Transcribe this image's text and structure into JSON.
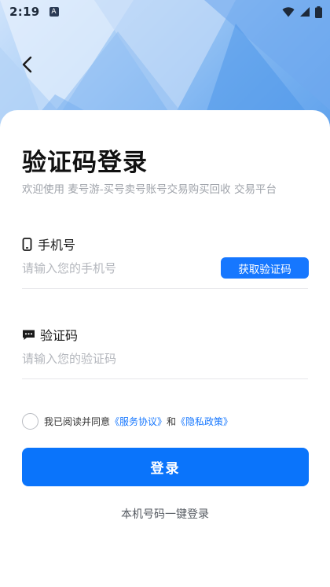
{
  "status_bar": {
    "time": "2:19",
    "indicator": "A",
    "icons": [
      "wifi-icon",
      "signal-icon",
      "battery-icon"
    ]
  },
  "header": {
    "back_icon": "chevron-left-icon"
  },
  "main": {
    "title": "验证码登录",
    "subtitle": "欢迎使用 麦号游-买号卖号账号交易购买回收 交易平台"
  },
  "phone_field": {
    "icon": "phone-icon",
    "label": "手机号",
    "placeholder": "请输入您的手机号",
    "value": "",
    "get_code_label": "获取验证码"
  },
  "code_field": {
    "icon": "message-icon",
    "label": "验证码",
    "placeholder": "请输入您的验证码",
    "value": ""
  },
  "agreement": {
    "checked": false,
    "prefix": "我已阅读并同意",
    "service_link": "《服务协议》",
    "conjunction": "和",
    "privacy_link": "《隐私政策》"
  },
  "login_button": {
    "label": "登录"
  },
  "one_key_login": {
    "label": "本机号码一键登录"
  },
  "colors": {
    "accent": "#1677ff",
    "primary_button": "#0a74fb",
    "placeholder": "#b4b7bd",
    "subtitle": "#a0a4ab"
  }
}
